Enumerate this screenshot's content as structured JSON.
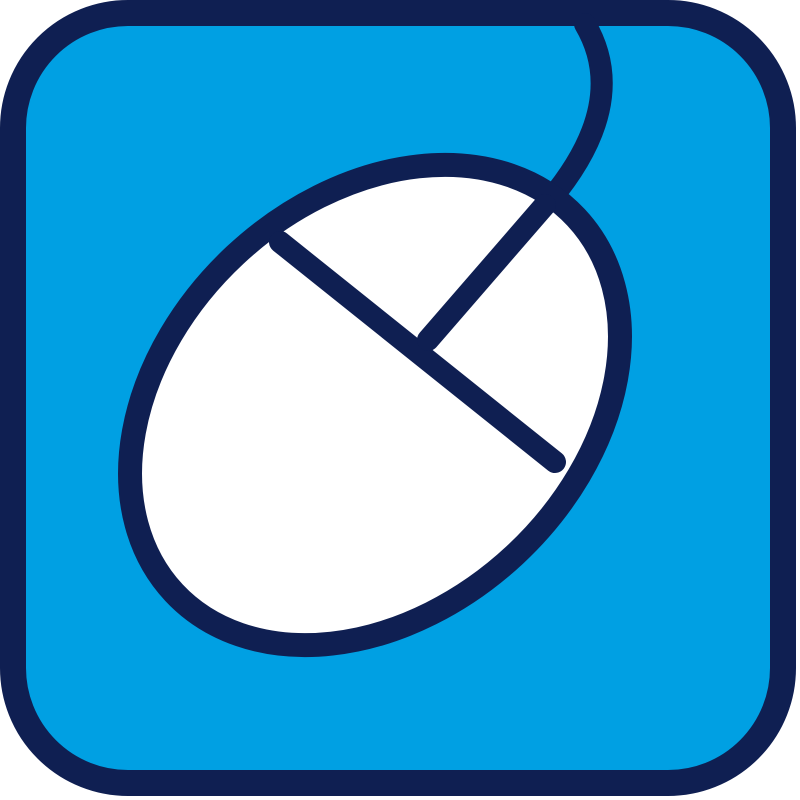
{
  "icon": {
    "name": "computer-mouse-icon",
    "colors": {
      "background": "#00A0E3",
      "outline": "#0F1F52",
      "mouse_body": "#FFFFFF"
    }
  }
}
